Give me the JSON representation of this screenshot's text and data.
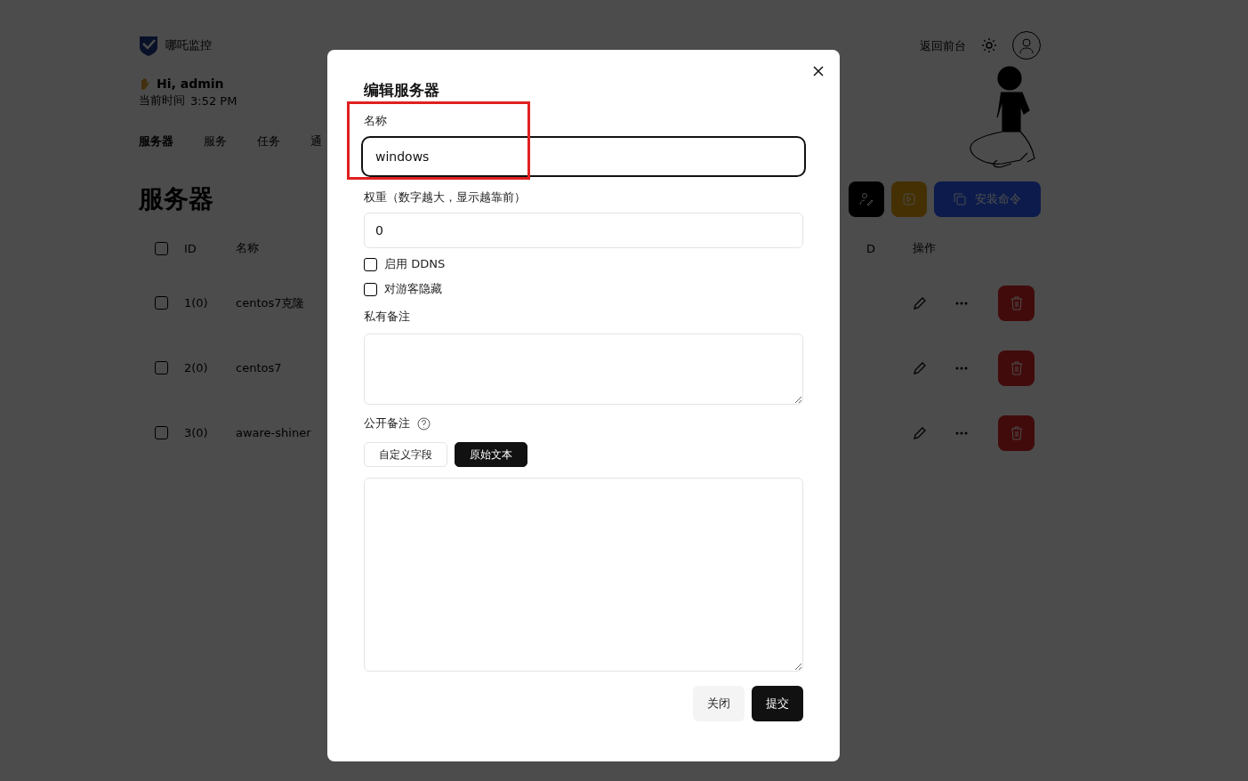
{
  "page": {
    "brand": "哪吒监控",
    "return_link": "返回前台",
    "greeting": "Hi, admin",
    "time_label": "当前时间",
    "time": "3:52 PM",
    "nav": [
      {
        "label": "服务器",
        "selected": true
      },
      {
        "label": "服务",
        "selected": false
      },
      {
        "label": "任务",
        "selected": false
      },
      {
        "label": "通",
        "selected": false
      }
    ],
    "title": "服务器",
    "install_button": "安装命令",
    "table": {
      "select_all_checked": false,
      "columns": [
        "ID",
        "名称",
        "D",
        "操作"
      ],
      "rows": [
        {
          "id": "1(0)",
          "name": "centos7克隆",
          "checked": false
        },
        {
          "id": "2(0)",
          "name": "centos7",
          "checked": false
        },
        {
          "id": "3(0)",
          "name": "aware-shiner",
          "checked": false
        }
      ]
    }
  },
  "dialog": {
    "title": "编辑服务器",
    "name_label": "名称",
    "name_value": "windows",
    "weight_label": "权重（数字越大，显示越靠前）",
    "weight_value": "0",
    "options": [
      {
        "label": "启用 DDNS",
        "checked": false
      },
      {
        "label": "对游客隐藏",
        "checked": false
      }
    ],
    "private_note_label": "私有备注",
    "public_note_label": "公开备注",
    "modes": [
      {
        "label": "自定义字段",
        "selected": false
      },
      {
        "label": "原始文本",
        "selected": true
      }
    ],
    "buttons": [
      {
        "label": "关闭",
        "kind": "secondary"
      },
      {
        "label": "提交",
        "kind": "primary"
      }
    ]
  }
}
